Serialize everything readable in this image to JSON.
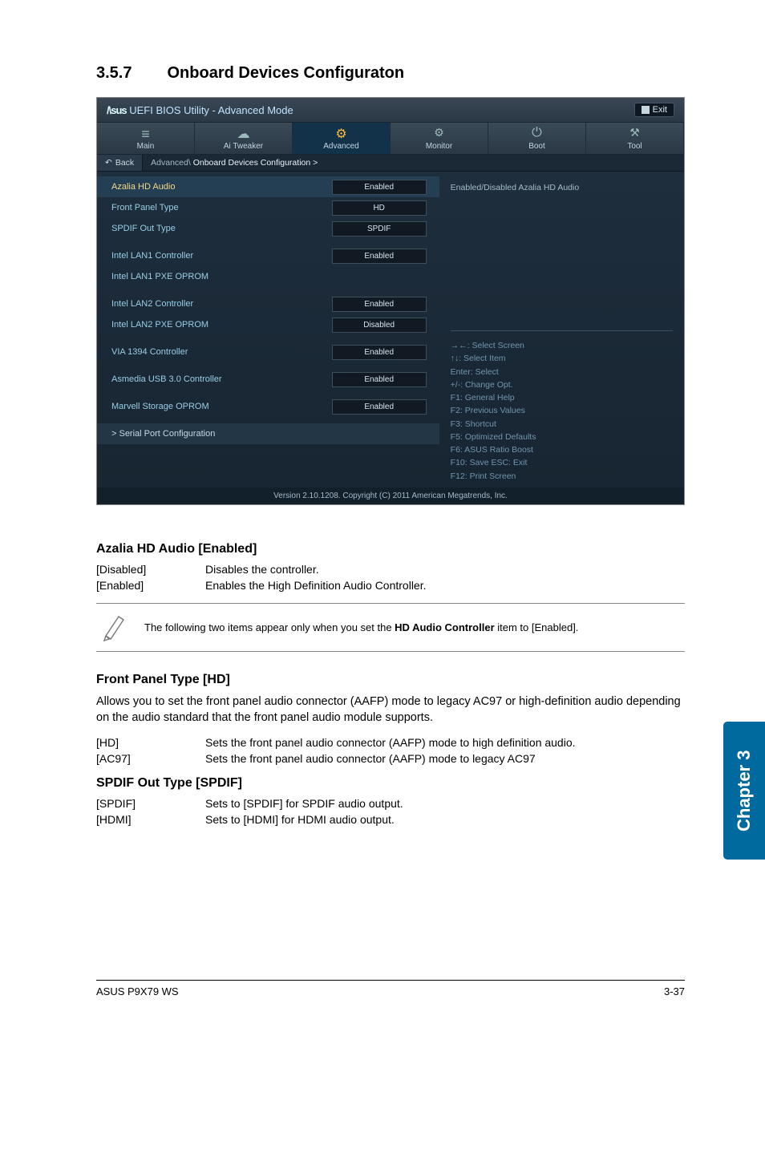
{
  "section": {
    "number": "3.5.7",
    "title": "Onboard Devices Configuraton"
  },
  "bios": {
    "brand": "/\\sus",
    "header": "UEFI BIOS Utility - Advanced Mode",
    "exit": "Exit",
    "tabs": {
      "main": "Main",
      "ai_tweaker": "Ai Tweaker",
      "advanced": "Advanced",
      "monitor": "Monitor",
      "boot": "Boot",
      "tool": "Tool"
    },
    "back": "Back",
    "bc_pre": "Advanced\\",
    "bc_hl": "Onboard Devices Configuration >",
    "rows": {
      "azalia": {
        "label": "Azalia HD Audio",
        "value": "Enabled"
      },
      "front": {
        "label": "Front Panel Type",
        "value": "HD"
      },
      "spdif": {
        "label": "SPDIF Out Type",
        "value": "SPDIF"
      },
      "lan1": {
        "label": "Intel LAN1 Controller",
        "value": "Enabled"
      },
      "lan1pxe": {
        "label": "Intel LAN1 PXE OPROM",
        "value": ""
      },
      "lan2": {
        "label": "Intel LAN2 Controller",
        "value": "Enabled"
      },
      "lan2pxe": {
        "label": "Intel LAN2 PXE OPROM",
        "value": "Disabled"
      },
      "via": {
        "label": "VIA 1394 Controller",
        "value": "Enabled"
      },
      "usb": {
        "label": "Asmedia USB 3.0 Controller",
        "value": "Enabled"
      },
      "marvell": {
        "label": "Marvell Storage OPROM",
        "value": "Enabled"
      },
      "serial": {
        "label": ">  Serial Port Configuration"
      }
    },
    "help": "Enabled/Disabled Azalia HD Audio",
    "keys": {
      "l1": "→←: Select Screen",
      "l2": "↑↓: Select Item",
      "l3": "Enter: Select",
      "l4": "+/-: Change Opt.",
      "l5": "F1: General Help",
      "l6": "F2: Previous Values",
      "l7": "F3: Shortcut",
      "l8": "F5: Optimized Defaults",
      "l9": "F6: ASUS Ratio Boost",
      "l10": "F10: Save   ESC: Exit",
      "l11": "F12: Print Screen"
    },
    "foot": "Version 2.10.1208.  Copyright (C) 2011 American Megatrends, Inc."
  },
  "azalia": {
    "heading": "Azalia HD Audio [Enabled]",
    "rows": [
      {
        "k": "[Disabled]",
        "v": "Disables the controller."
      },
      {
        "k": "[Enabled]",
        "v": "Enables the High Definition Audio Controller."
      }
    ]
  },
  "note": {
    "pre": "The following two items appear only when you set the ",
    "bold": "HD Audio Controller",
    "post": " item to [Enabled]."
  },
  "front": {
    "heading": "Front Panel Type [HD]",
    "para": "Allows you to set the front panel audio connector (AAFP) mode to legacy AC97 or high-definition audio depending on the audio standard that the front panel audio module supports.",
    "rows": [
      {
        "k": "[HD]",
        "v": "Sets the front panel audio connector (AAFP) mode to high definition audio."
      },
      {
        "k": "[AC97]",
        "v": "Sets the front panel audio connector (AAFP) mode to legacy AC97"
      }
    ]
  },
  "spdif": {
    "heading": "SPDIF Out Type [SPDIF]",
    "rows": [
      {
        "k": "[SPDIF]",
        "v": "Sets to [SPDIF] for SPDIF audio output."
      },
      {
        "k": "[HDMI]",
        "v": "Sets to [HDMI] for HDMI audio output."
      }
    ]
  },
  "side_tab": "Chapter 3",
  "footer": {
    "left": "ASUS P9X79 WS",
    "right": "3-37"
  }
}
